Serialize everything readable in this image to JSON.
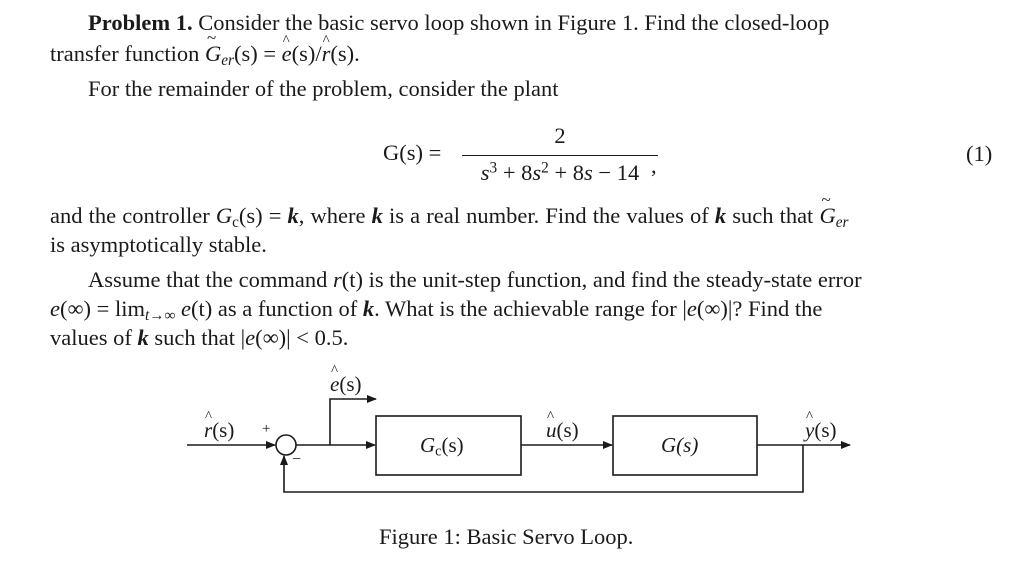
{
  "problem": {
    "heading": "Problem 1.",
    "p1_line1_rest": "Consider the basic servo loop shown in Figure 1.  Find the closed-loop",
    "p1_line2_pre": "transfer function ",
    "p1_line2_G": "G",
    "p1_line2_sub": "er",
    "p1_line2_mid": "(s) = ",
    "p1_line2_e": "e",
    "p1_line2_mid2": "(s)/",
    "p1_line2_r": "r",
    "p1_line2_end": "(s).",
    "p2": "For the remainder of the problem, consider the plant",
    "eq1": {
      "lhs": "G(s) =",
      "numerator": "2",
      "denominator_parts": [
        "s",
        "3",
        " + 8",
        "s",
        "2",
        " + 8",
        "s",
        " − 14"
      ],
      "trailing": ",",
      "number": "(1)"
    },
    "p3_line1": {
      "a": "and the controller ",
      "G": "G",
      "sub": "c",
      "b": "(s) = ",
      "k1": "k",
      "c": ", where ",
      "k2": "k",
      "d": " is a real number.  Find the values of ",
      "k3": "k",
      "e": " such that ",
      "G2": "G",
      "sub2": "er"
    },
    "p3_line2": "is asymptotically stable.",
    "p4_line1": {
      "a": "Assume that the command ",
      "r": "r",
      "b": "(t)",
      "c": " is the unit-step function, and find the steady-state error"
    },
    "p4_line2": {
      "e": "e",
      "a": "(∞) = lim",
      "sub": "t→∞",
      "b": " ",
      "e2": "e",
      "c": "(t)",
      "d": " as a function of ",
      "k": "k",
      "f": ".  What is the achievable range for |",
      "e3": "e",
      "g": "(∞)|?  Find the"
    },
    "p4_line3": {
      "a": "values of ",
      "k": "k",
      "b": " such that |",
      "e": "e",
      "c": "(∞)| < 0.5."
    }
  },
  "figure": {
    "labels": {
      "r": "r",
      "r_arg": "(s)",
      "e": "e",
      "e_arg": "(s)",
      "u": "u",
      "u_arg": "(s)",
      "y": "y",
      "y_arg": "(s)",
      "plus": "+",
      "minus": "−",
      "controller_G": "G",
      "controller_sub": "c",
      "controller_arg": "(s)",
      "plant": "G(s)"
    },
    "caption": "Figure 1:  Basic Servo Loop."
  }
}
